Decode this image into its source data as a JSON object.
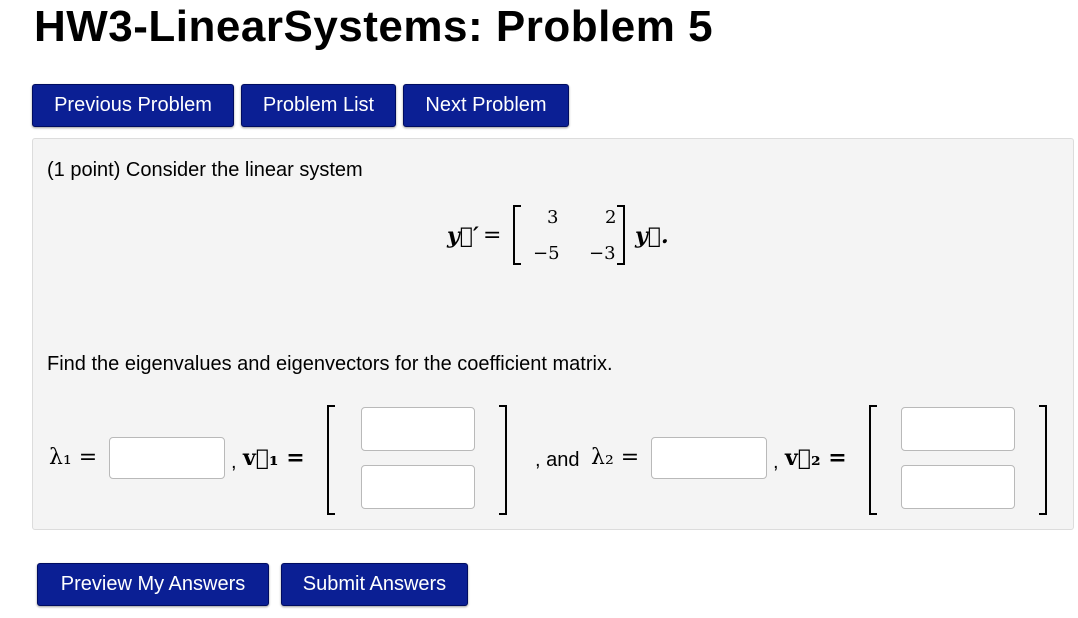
{
  "page": {
    "title": "HW3-LinearSystems: Problem 5"
  },
  "nav": {
    "previous": "Previous Problem",
    "list": "Problem List",
    "next": "Next Problem"
  },
  "problem": {
    "intro": "(1 point) Consider the linear system",
    "equation": {
      "lhs": "y⃗′",
      "equals": "=",
      "matrix": [
        [
          "3",
          "2"
        ],
        [
          "−5",
          "−3"
        ]
      ],
      "rhs": "y⃗."
    },
    "instruction": "Find the eigenvalues and eigenvectors for the coefficient matrix.",
    "answers": {
      "lambda1": "λ₁ =",
      "comma1": ",",
      "v1": "v⃗₁ =",
      "and_text": ", and",
      "lambda2": "λ₂ =",
      "comma2": ",",
      "v2": "v⃗₂ ="
    }
  },
  "footer": {
    "preview": "Preview My Answers",
    "submit": "Submit Answers"
  },
  "colors": {
    "button_bg": "#0b1f94",
    "panel_bg": "#f4f4f4"
  }
}
